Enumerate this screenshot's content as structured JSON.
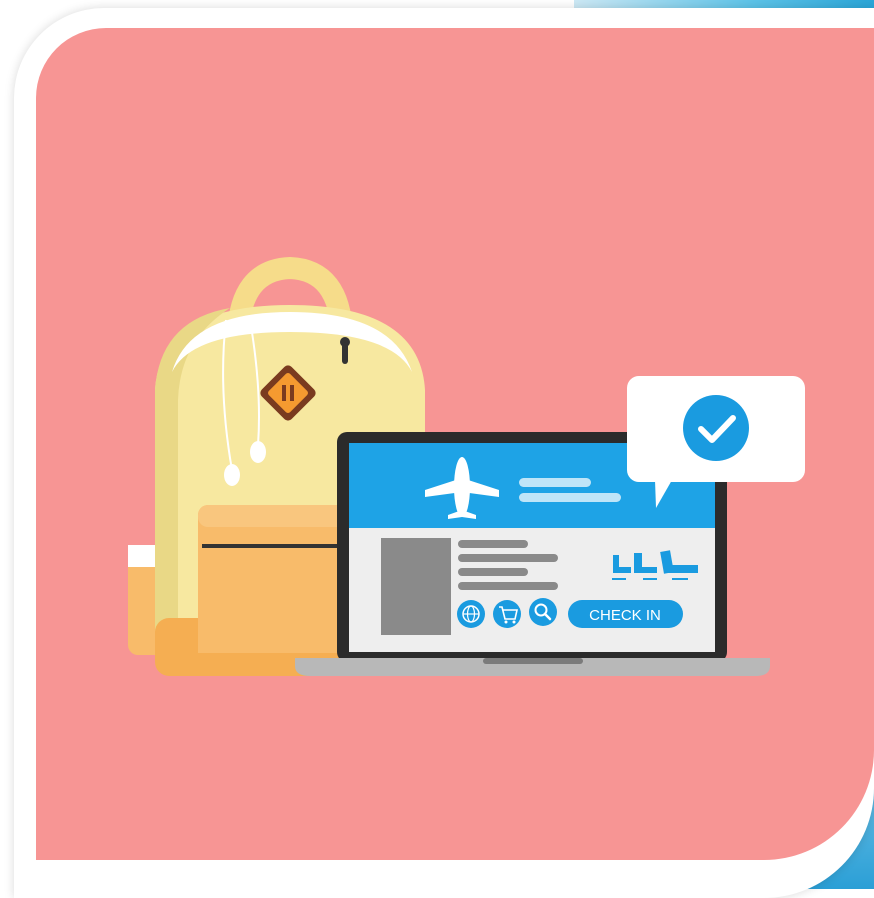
{
  "illustration": {
    "check_in_label": "CHECK IN",
    "icons": [
      "backpack-icon",
      "earphones-icon",
      "laptop-icon",
      "airplane-icon",
      "checkmark-icon",
      "globe-icon",
      "cart-icon",
      "search-icon",
      "seat-icon"
    ],
    "colors": {
      "background": "#f79594",
      "screen_header": "#1ea3e6",
      "accent_blue": "#1a9be0",
      "backpack": "#f7e8a0",
      "pocket": "#f8bb6a",
      "frame_blue": "#2aa6d8"
    }
  }
}
